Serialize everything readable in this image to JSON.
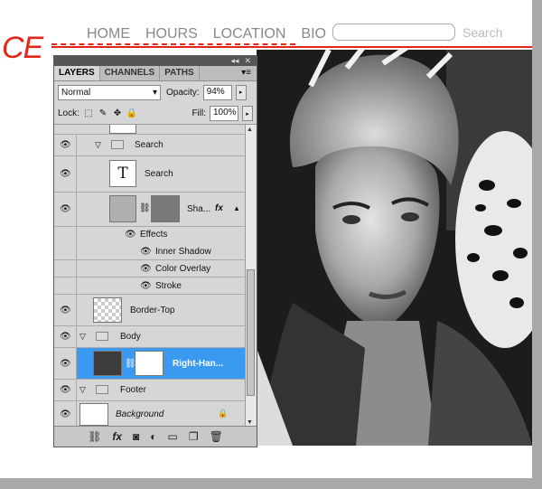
{
  "page": {
    "logo_text": "CE",
    "nav": [
      "HOME",
      "HOURS",
      "LOCATION",
      "BIO"
    ],
    "search_label": "Search"
  },
  "panel": {
    "tabs": [
      "LAYERS",
      "CHANNELS",
      "PATHS"
    ],
    "blend_mode": "Normal",
    "opacity_label": "Opacity:",
    "opacity_value": "94%",
    "lock_label": "Lock:",
    "fill_label": "Fill:",
    "fill_value": "100%",
    "layers": [
      {
        "name": "Search",
        "kind": "group"
      },
      {
        "name": "Search",
        "kind": "text"
      },
      {
        "name": "Sha...",
        "kind": "shape"
      },
      {
        "name": "Effects",
        "kind": "effects"
      },
      {
        "name": "Inner Shadow",
        "kind": "effect"
      },
      {
        "name": "Color Overlay",
        "kind": "effect"
      },
      {
        "name": "Stroke",
        "kind": "effect"
      },
      {
        "name": "Border-Top",
        "kind": "layer"
      },
      {
        "name": "Body",
        "kind": "group"
      },
      {
        "name": "Right-Han...",
        "kind": "layer-selected"
      },
      {
        "name": "Footer",
        "kind": "group"
      },
      {
        "name": "Background",
        "kind": "background"
      }
    ]
  },
  "colors": {
    "accent_red": "#e1261c",
    "selection_blue": "#3a9af0"
  }
}
